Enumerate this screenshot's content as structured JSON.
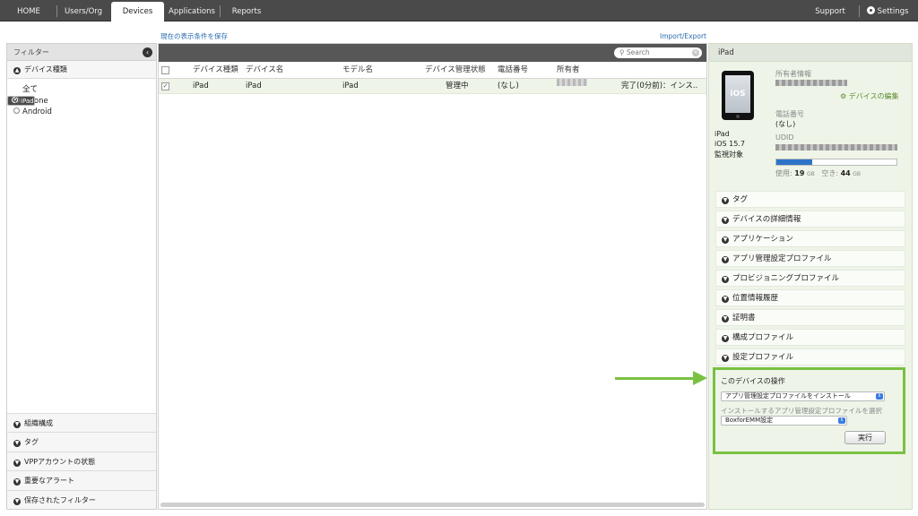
{
  "nav": {
    "tabs": [
      "HOME",
      "Users/Org",
      "Devices",
      "Applications",
      "Reports"
    ],
    "active": "Devices",
    "support": "Support",
    "settings": "Settings"
  },
  "links": {
    "save_filter": "現在の表示条件を保存",
    "import_export": "Import/Export"
  },
  "filter": {
    "title": "フィルター",
    "device_type_section": "デバイス種類",
    "device_types": [
      "全て",
      "iPad",
      "iPhone",
      "Android"
    ],
    "selected_type": "iPad",
    "bottom_sections": [
      "組織構成",
      "タグ",
      "VPPアカウントの状態",
      "重要なアラート",
      "保存されたフィルター"
    ]
  },
  "table": {
    "search_placeholder": "Search",
    "columns": [
      "デバイス種類",
      "デバイス名",
      "モデル名",
      "デバイス管理状態",
      "電話番号",
      "所有者"
    ],
    "rows": [
      {
        "checked": true,
        "device_type": "iPad",
        "device_name": "iPad",
        "model": "iPad",
        "management_state": "管理中",
        "phone": "(なし)",
        "status": "完了(0分前)：インス.."
      }
    ]
  },
  "detail": {
    "title": "iPad",
    "device_name": "iPad",
    "os": "iOS 15.7",
    "supervised": "監視対象",
    "owner_label": "所有者情報",
    "edit_device": "デバイスの編集",
    "phone_label": "電話番号",
    "phone_value": "(なし)",
    "udid_label": "UDID",
    "storage": {
      "used_label": "使用:",
      "used": "19",
      "free_label": "空き:",
      "free": "44",
      "unit": "GB",
      "used_fraction": 0.3
    },
    "sections": [
      "タグ",
      "デバイスの詳細情報",
      "アプリケーション",
      "アプリ管理設定プロファイル",
      "プロビジョニングプロファイル",
      "位置情報履歴",
      "証明書",
      "構成プロファイル",
      "設定プロファイル"
    ],
    "operations": {
      "title": "このデバイスの操作",
      "action_select": "アプリ管理設定プロファイルをインストール",
      "profile_prompt": "インストールするアプリ管理設定プロファイルを選択",
      "profile_select": "BoxforEMM設定",
      "run_button": "実行"
    }
  },
  "colors": {
    "accent_green": "#7ac143",
    "nav_bg": "#4a4a4a",
    "link_blue": "#2a6bb0",
    "storage_blue": "#2d74c9"
  }
}
